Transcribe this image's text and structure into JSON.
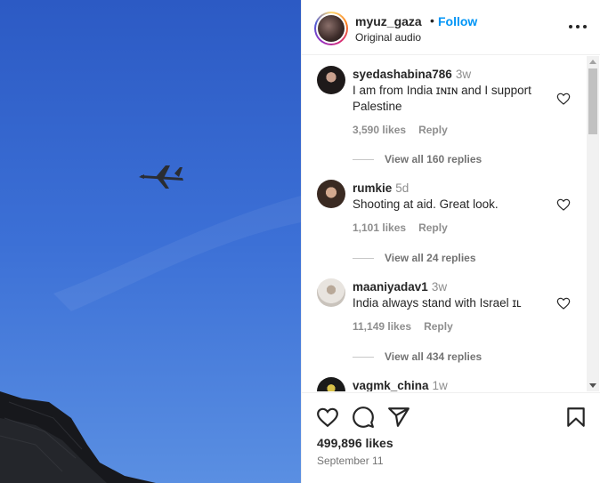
{
  "post": {
    "username": "myuz_gaza",
    "follow_label": "Follow",
    "separator": "•",
    "audio": "Original audio",
    "likes": "499,896 likes",
    "date": "September 11"
  },
  "comments": [
    {
      "username": "syedashabina786",
      "time": "3w",
      "text": "I am from India ɪɴɪɴ and I support Palestine",
      "likes": "3,590 likes",
      "reply_label": "Reply",
      "replies": "View all 160 replies"
    },
    {
      "username": "rumkie",
      "time": "5d",
      "text": "Shooting at aid. Great look.",
      "likes": "1,101 likes",
      "reply_label": "Reply",
      "replies": "View all 24 replies"
    },
    {
      "username": "maaniyadav1",
      "time": "3w",
      "text": "India always stand with Israel ɪʟ",
      "likes": "11,149 likes",
      "reply_label": "Reply",
      "replies": "View all 434 replies"
    },
    {
      "username": "vagmk_china",
      "time": "1w"
    }
  ],
  "icons": {
    "like": "heart-icon",
    "comment": "comment-icon",
    "share": "share-icon",
    "save": "bookmark-icon",
    "more": "more-icon"
  },
  "colors": {
    "accent": "#0095f6",
    "sky": "#3a6dd4",
    "text": "#262626",
    "muted": "#8e8e8e"
  }
}
